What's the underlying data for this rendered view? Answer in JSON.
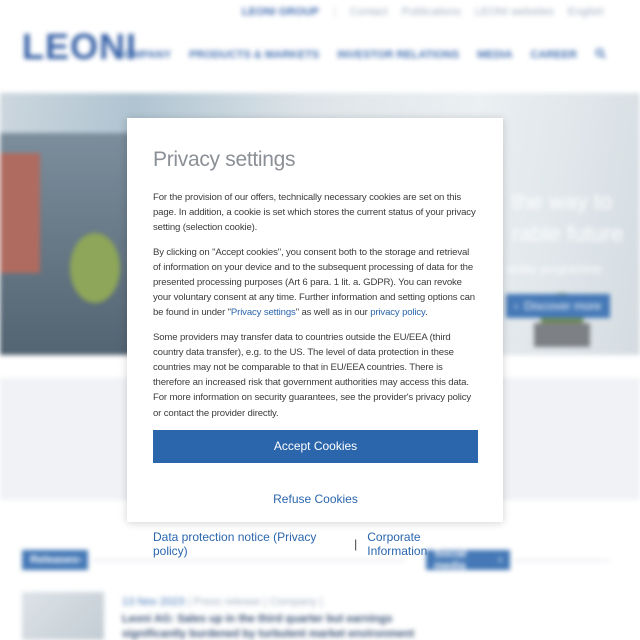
{
  "header": {
    "top_links": [
      {
        "label": "LEONI GROUP",
        "primary": true
      },
      {
        "label": "Contact",
        "primary": false
      },
      {
        "label": "Publications",
        "primary": false
      },
      {
        "label": "LEONI websites",
        "primary": false
      },
      {
        "label": "English",
        "primary": false
      }
    ],
    "logo_text": "LEONI",
    "nav": [
      "COMPANY",
      "PRODUCTS & MARKETS",
      "INVESTOR RELATIONS",
      "MEDIA",
      "CAREER"
    ]
  },
  "hero": {
    "title_line1": "the way to",
    "title_line2": "rable future",
    "subtitle": "ability programme",
    "button_label": "Discover more"
  },
  "sections": {
    "left_tag": "Releases",
    "right_tag": "Social media"
  },
  "news": {
    "date": "13 Nov 2023",
    "meta": "| Press release | Company |",
    "title": "Leoni AG: Sales up in the third quarter but earnings significantly burdened by turbulent market environment"
  },
  "privacy_modal": {
    "title": "Privacy settings",
    "paragraph1": "For the provision of our offers, technically necessary cookies are set on this page. In addition, a cookie is set which stores the current status of your privacy setting (selection cookie).",
    "paragraph2_part1": "By clicking on \"Accept cookies\", you consent both to the storage and retrieval of information on your device and to the subsequent processing of data for the presented processing purposes (Art 6 para. 1 lit. a. GDPR). You can revoke your voluntary consent at any time. Further information and setting options can be found in under \"",
    "privacy_settings_link": "Privacy settings",
    "paragraph2_part2": "\" as well as in our ",
    "privacy_policy_link": "privacy policy",
    "paragraph2_part3": ".",
    "paragraph3": "Some providers may transfer data to countries outside the EU/EEA (third country data transfer), e.g. to the US. The level of data protection in these countries may not be comparable to that in EU/EEA countries. There is therefore an increased risk that government authorities may access this data. For more information on security guarantees, see the provider's privacy policy or contact the provider directly.",
    "accept_label": "Accept Cookies",
    "refuse_label": "Refuse Cookies",
    "data_protection_link": "Data protection notice (Privacy policy)",
    "footer_divider": "|",
    "corporate_info_link": "Corporate Information"
  },
  "colors": {
    "brand_blue": "#2b66ad",
    "logo_blue": "#1f4e9c",
    "title_grey": "#8a9096",
    "text": "#3c3c3c"
  }
}
